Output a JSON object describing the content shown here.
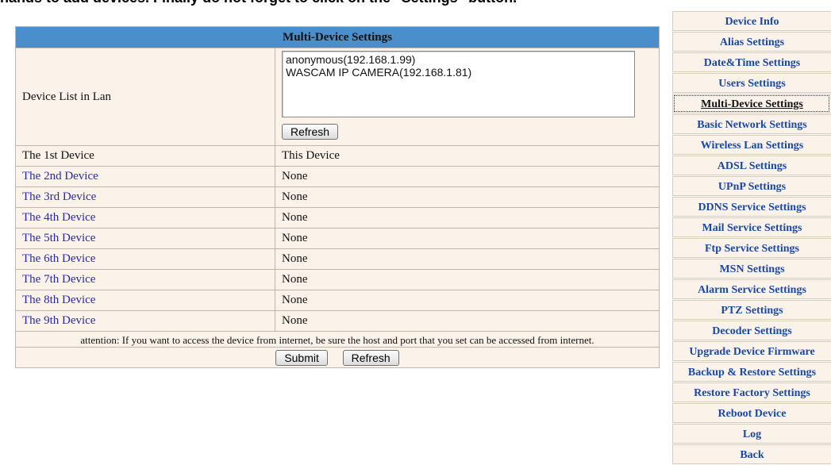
{
  "top_text": "nands to add devices. Finally do not forget to click on the \"Settings\" button.",
  "panel": {
    "title": "Multi-Device Settings",
    "device_list_label": "Device List in Lan",
    "device_list": [
      "anonymous(192.168.1.99)",
      "WASCAM IP CAMERA(192.168.1.81)"
    ],
    "refresh_label": "Refresh",
    "devices": [
      {
        "label": "The 1st Device",
        "value": "This Device"
      },
      {
        "label": "The 2nd Device",
        "value": "None"
      },
      {
        "label": "The 3rd Device",
        "value": "None"
      },
      {
        "label": "The 4th Device",
        "value": "None"
      },
      {
        "label": "The 5th Device",
        "value": "None"
      },
      {
        "label": "The 6th Device",
        "value": "None"
      },
      {
        "label": "The 7th Device",
        "value": "None"
      },
      {
        "label": "The 8th Device",
        "value": "None"
      },
      {
        "label": "The 9th Device",
        "value": "None"
      }
    ],
    "attention": "attention: If you want to access the device from internet, be sure the host and port that you set can be accessed from internet.",
    "submit_label": "Submit",
    "refresh_bottom_label": "Refresh"
  },
  "sidebar": {
    "active": "Multi-Device Settings",
    "items": [
      "Device Info",
      "Alias Settings",
      "Date&Time Settings",
      "Users Settings",
      "Multi-Device Settings",
      "Basic Network Settings",
      "Wireless Lan Settings",
      "ADSL Settings",
      "UPnP Settings",
      "DDNS Service Settings",
      "Mail Service Settings",
      "Ftp Service Settings",
      "MSN Settings",
      "Alarm Service Settings",
      "PTZ Settings",
      "Decoder Settings",
      "Upgrade Device Firmware",
      "Backup & Restore Settings",
      "Restore Factory Settings",
      "Reboot Device",
      "Log",
      "Back"
    ]
  },
  "colors": {
    "header_bg": "#4a8fcb",
    "panel_bg": "#fbf3ea",
    "link": "#1a48a8"
  }
}
